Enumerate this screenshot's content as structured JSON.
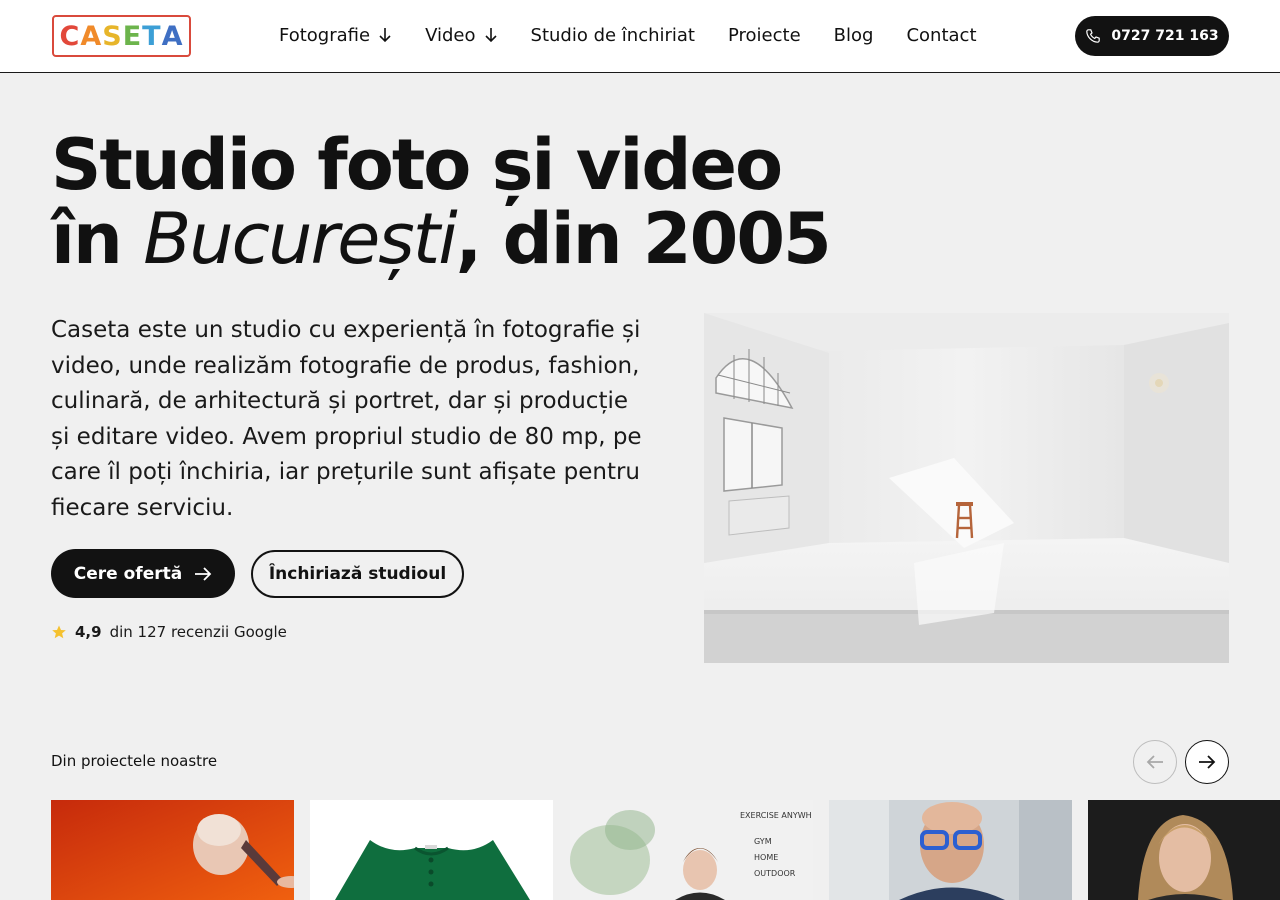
{
  "header": {
    "logo_text": "CASETA",
    "logo_letters": [
      "C",
      "A",
      "S",
      "E",
      "T",
      "A"
    ],
    "logo_colors": [
      "#e2483a",
      "#f08a2a",
      "#e7b52a",
      "#6cb44c",
      "#3c9fd6",
      "#3f6fc3"
    ],
    "nav": [
      {
        "label": "Fotografie",
        "has_dropdown": true
      },
      {
        "label": "Video",
        "has_dropdown": true
      },
      {
        "label": "Studio de închiriat",
        "has_dropdown": false
      },
      {
        "label": "Proiecte",
        "has_dropdown": false
      },
      {
        "label": "Blog",
        "has_dropdown": false
      },
      {
        "label": "Contact",
        "has_dropdown": false
      }
    ],
    "phone": "0727 721 163",
    "phone_icon": "phone-icon"
  },
  "hero": {
    "title_line1": "Studio foto și video",
    "title_line2_prefix": "în ",
    "title_line2_italic": "București",
    "title_line2_suffix": ", din 2005",
    "description": "Caseta este un studio cu experiență în fotografie și video, unde realizăm fotografie de produs, fashion, culinară, de arhitectură și portret, dar și producție și editare video. Avem propriul studio de 80 mp, pe care îl poți închiria, iar prețurile sunt afișate pentru fiecare serviciu.",
    "cta_primary": "Cere ofertă",
    "cta_secondary": "Închiriază studioul",
    "rating_value": "4,9",
    "rating_text": "din 127 recenzii Google",
    "star_color": "#f5c12e"
  },
  "projects": {
    "label": "Din proiectele noastre",
    "prev_icon": "arrow-left-icon",
    "next_icon": "arrow-right-icon",
    "gym_sign": {
      "title": "EXERCISE ANYWH",
      "items": [
        "GYM",
        "HOME",
        "OUTDOOR"
      ]
    }
  },
  "colors": {
    "background": "#f0f0f0",
    "dark": "#121212",
    "header_bg": "#ffffff"
  }
}
